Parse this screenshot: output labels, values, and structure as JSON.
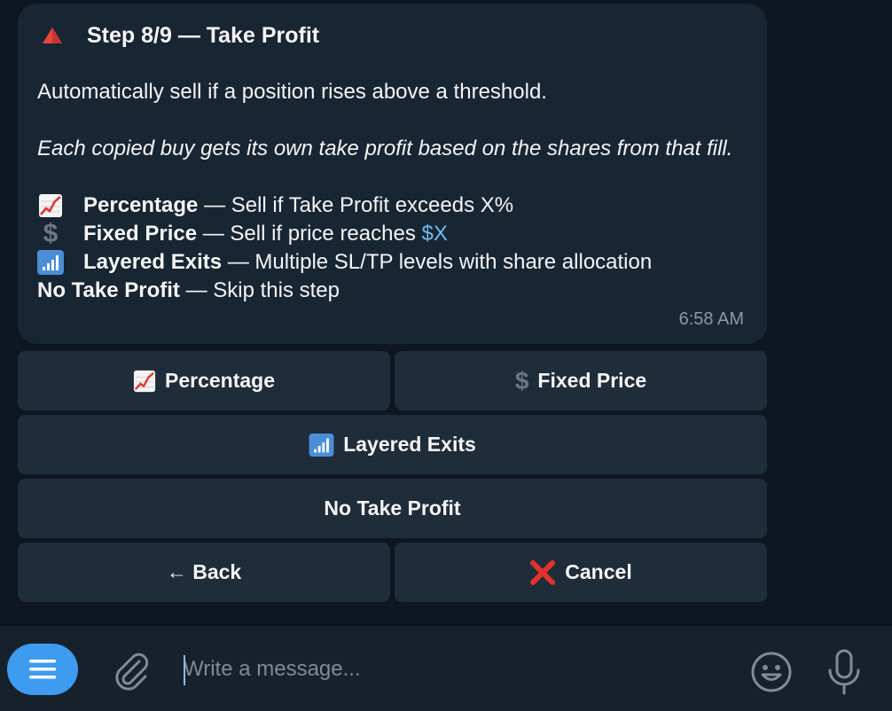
{
  "message": {
    "title": "Step 8/9 — Take Profit",
    "description": "Automatically sell if a position rises above a threshold.",
    "italic_note": "Each copied buy gets its own take profit based on the shares from that fill.",
    "options": [
      {
        "icon": "chart-increasing-icon",
        "name": "Percentage",
        "desc": " — Sell if Take Profit exceeds X%"
      },
      {
        "icon": "dollar-sign-icon",
        "name": "Fixed Price",
        "desc": " — Sell if price reaches ",
        "link": "$X"
      },
      {
        "icon": "signal-bars-icon",
        "name": "Layered Exits",
        "desc": " — Multiple SL/TP levels with share allocation"
      },
      {
        "icon": "",
        "name": "No Take Profit",
        "desc": " — Skip this step"
      }
    ],
    "time": "6:58 AM"
  },
  "keyboard": {
    "percentage": "Percentage",
    "fixed_price": "Fixed Price",
    "layered_exits": "Layered Exits",
    "no_take_profit": "No Take Profit",
    "back": "← Back",
    "cancel": "Cancel"
  },
  "input": {
    "placeholder": "Write a message..."
  },
  "colors": {
    "chat_bg": "#0e1621",
    "bubble_bg": "#182533",
    "button_bg": "#1f2c3a",
    "accent": "#3e9cf0",
    "link": "#71baf2"
  }
}
